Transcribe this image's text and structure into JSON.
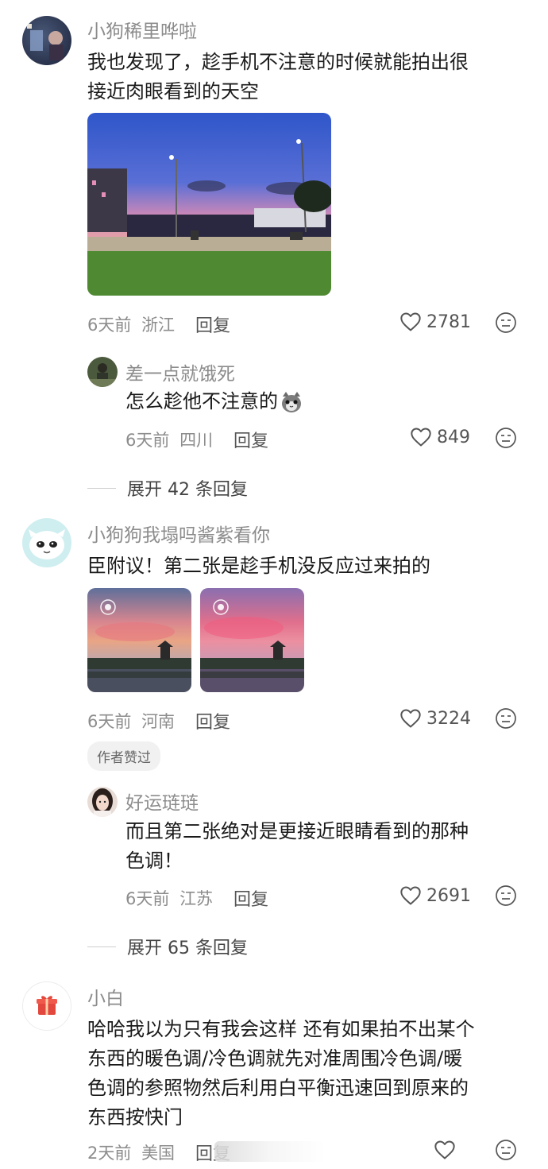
{
  "comments": [
    {
      "username": "小狗稀里哗啦",
      "content_line1": "我也发现了，趁手机不注意的时候就能拍出很",
      "content_line2": "接近肉眼看到的天空",
      "time": "6天前",
      "location": "浙江",
      "reply_label": "回复",
      "likes": "2781",
      "sub_reply": {
        "username": "差一点就饿死",
        "content": "怎么趁他不注意的",
        "time": "6天前",
        "location": "四川",
        "reply_label": "回复",
        "likes": "849"
      },
      "expand_text": "展开 42 条回复"
    },
    {
      "username": "小狗狗我塌吗酱紫看你",
      "content": "臣附议！第二张是趁手机没反应过来拍的",
      "time": "6天前",
      "location": "河南",
      "reply_label": "回复",
      "likes": "3224",
      "badge": "作者赞过",
      "sub_reply": {
        "username": "好运琏琏",
        "content_line1": "而且第二张绝对是更接近眼睛看到的那种",
        "content_line2": "色调！",
        "time": "6天前",
        "location": "江苏",
        "reply_label": "回复",
        "likes": "2691"
      },
      "expand_text": "展开 65 条回复"
    },
    {
      "username": "小白",
      "content_line1": "哈哈我以为只有我会这样 还有如果拍不出某个",
      "content_line2": "东西的暖色调/冷色调就先对准周围冷色调/暖",
      "content_line3": "色调的参照物然后利用白平衡迅速回到原来的",
      "content_line4": "东西按快门",
      "time": "2天前",
      "location": "美国",
      "reply_label": "回复"
    }
  ],
  "colors": {
    "meta_gray": "#8c8c8c",
    "badge_bg": "#f1f1f1",
    "text": "#1a1a1a"
  }
}
